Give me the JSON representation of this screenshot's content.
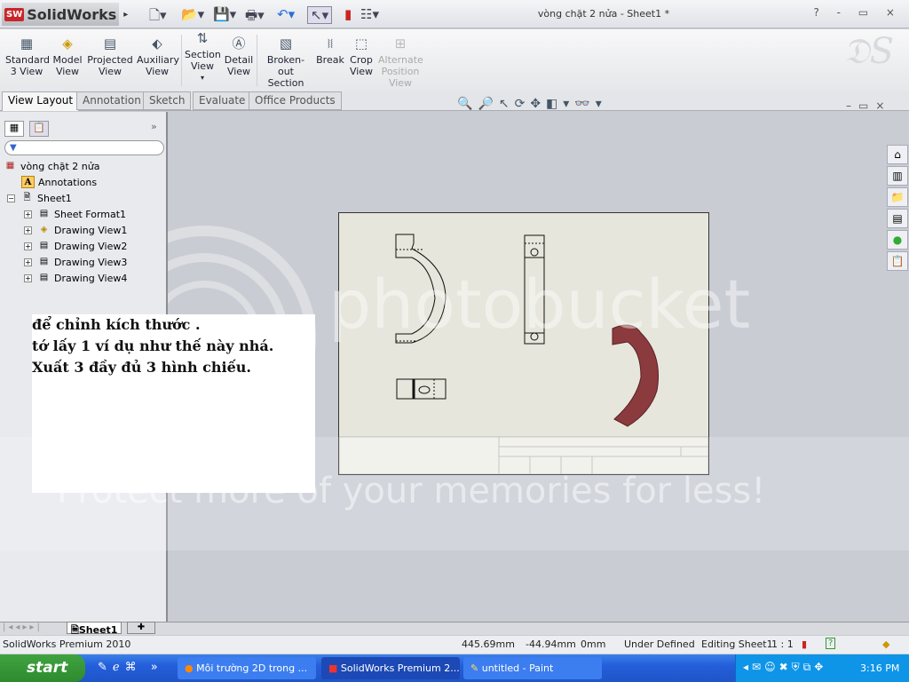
{
  "app": {
    "name": "SolidWorks",
    "doc_title": "vòng chặt 2 nửa - Sheet1 *",
    "window_controls": "? - ▭ ×"
  },
  "toolbar": {
    "items": [
      {
        "label": "Standard 3 View",
        "icon": "standard-3-view-icon"
      },
      {
        "label": "Model View",
        "icon": "model-view-icon"
      },
      {
        "label": "Projected View",
        "icon": "projected-view-icon"
      },
      {
        "label": "Auxiliary View",
        "icon": "auxiliary-view-icon"
      },
      {
        "label": "Section View",
        "icon": "section-view-icon"
      },
      {
        "label": "Detail View",
        "icon": "detail-view-icon"
      },
      {
        "label": "Broken-out Section",
        "icon": "broken-out-section-icon"
      },
      {
        "label": "Break",
        "icon": "break-icon"
      },
      {
        "label": "Crop View",
        "icon": "crop-view-icon"
      },
      {
        "label": "Alternate Position View",
        "icon": "alternate-position-view-icon",
        "disabled": true
      }
    ]
  },
  "tabs": [
    {
      "label": "View Layout",
      "active": true
    },
    {
      "label": "Annotation"
    },
    {
      "label": "Sketch"
    },
    {
      "label": "Evaluate"
    },
    {
      "label": "Office Products"
    }
  ],
  "tree": {
    "root": "vòng chặt 2 nửa",
    "items": [
      {
        "label": "Annotations"
      },
      {
        "label": "Sheet1"
      },
      {
        "label": "Sheet Format1"
      },
      {
        "label": "Drawing View1"
      },
      {
        "label": "Drawing View2"
      },
      {
        "label": "Drawing View3"
      },
      {
        "label": "Drawing View4"
      }
    ]
  },
  "note": {
    "lines": [
      "để chỉnh kích thước .",
      "tớ lấy 1 ví dụ như thế này nhá.",
      "Xuất 3 đầy đủ 3 hình chiếu."
    ]
  },
  "watermark": {
    "brand": "photobucket",
    "slogan": "Protect more of your memories for less!"
  },
  "sheet_tabs": {
    "active": "Sheet1"
  },
  "status": {
    "product": "SolidWorks Premium 2010",
    "x": "445.69mm",
    "y": "-44.94mm",
    "z": "0mm",
    "state": "Under Defined",
    "editing": "Editing Sheet1",
    "scale": "1 : 1"
  },
  "taskbar": {
    "start": "start",
    "tasks": [
      {
        "label": "Môi trường 2D trong ..."
      },
      {
        "label": "SolidWorks Premium 2...",
        "active": true
      },
      {
        "label": "untitled - Paint"
      }
    ],
    "clock": "3:16 PM"
  },
  "colors": {
    "model": "#8b3a3e",
    "sheet": "#e6e6dc",
    "accent": "#c8262b"
  }
}
